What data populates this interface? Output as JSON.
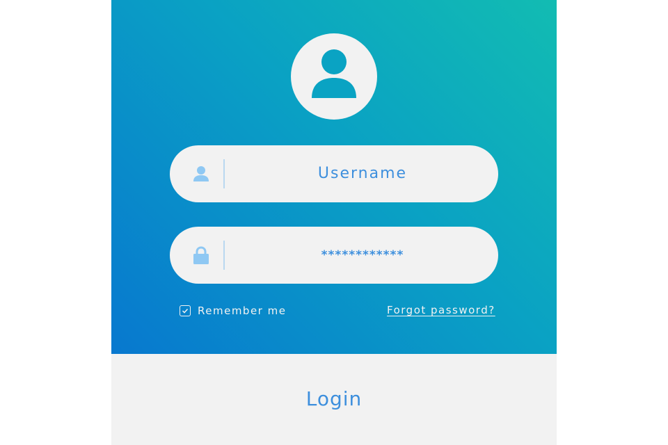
{
  "form": {
    "avatar_icon": "user-avatar-icon",
    "username": {
      "icon": "user-icon",
      "placeholder": "Username"
    },
    "password": {
      "icon": "lock-icon",
      "value": "************"
    },
    "remember": {
      "label": "Remember me",
      "checked": true
    },
    "forgot_label": "Forgot password?",
    "login_label": "Login"
  },
  "colors": {
    "gradient_start": "#12bcb2",
    "gradient_end": "#0878cf",
    "field_bg": "#f2f2f2",
    "accent_text": "#3d8fdd",
    "icon_light": "#8fc8f3"
  }
}
